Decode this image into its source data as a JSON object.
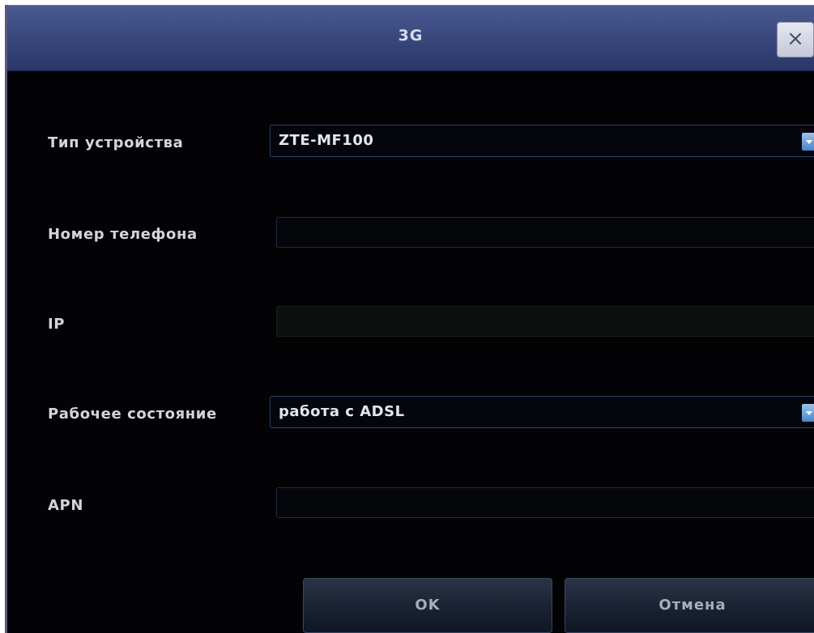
{
  "dialog": {
    "title": "3G",
    "close_label": "×"
  },
  "fields": {
    "device_type": {
      "label": "Тип устройства",
      "value": "ZTE-MF100"
    },
    "phone_number": {
      "label": "Номер телефона",
      "value": ""
    },
    "ip": {
      "label": "IP",
      "value": ""
    },
    "working_state": {
      "label": "Рабочее состояние",
      "value": "работа с ADSL"
    },
    "apn": {
      "label": "APN",
      "value": ""
    }
  },
  "buttons": {
    "ok": "OK",
    "cancel": "Отмена"
  },
  "colors": {
    "titlebar": "#3a4a80",
    "background": "#030305",
    "accent": "#4a86cc"
  }
}
